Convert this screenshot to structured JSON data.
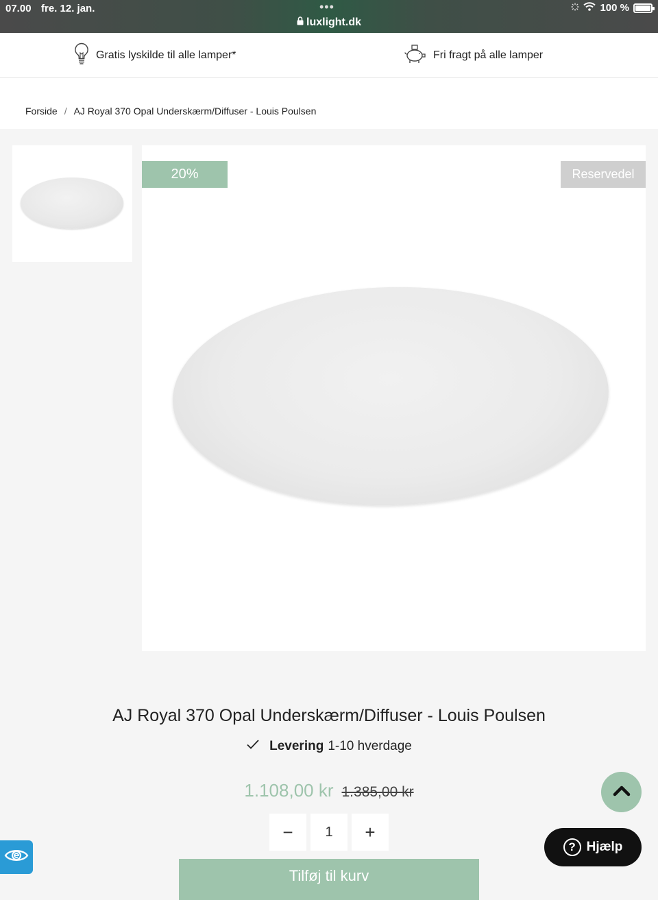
{
  "status_bar": {
    "time": "07.00",
    "date": "fre. 12. jan.",
    "dots": "•••",
    "url": "luxlight.dk",
    "battery": "100 %"
  },
  "usp": {
    "item1": "Gratis lyskilde til alle lamper*",
    "item2": "Fri fragt på alle lamper"
  },
  "breadcrumb": {
    "home": "Forside",
    "separator": "/",
    "current": "AJ Royal 370 Opal Underskærm/Diffuser - Louis Poulsen"
  },
  "badges": {
    "discount": "20%",
    "category": "Reservedel"
  },
  "product": {
    "title": "AJ Royal 370 Opal Underskærm/Diffuser - Louis Poulsen",
    "delivery_label": "Levering",
    "delivery_value": "1-10 hverdage",
    "price_now": "1.108,00 kr",
    "price_old": "1.385,00 kr",
    "quantity": "1",
    "qty_minus": "−",
    "qty_plus": "+",
    "add_to_cart": "Tilføj til kurv"
  },
  "widgets": {
    "help_label": "Hjælp",
    "help_symbol": "?"
  },
  "colors": {
    "accent": "#9ec4ac",
    "reserve_badge": "#cfcfcf",
    "accessibility": "#2a9bd6"
  }
}
